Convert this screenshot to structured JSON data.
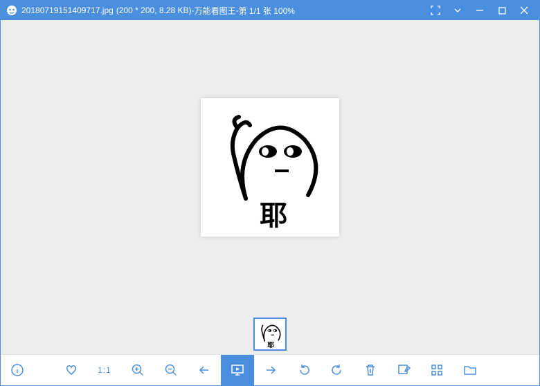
{
  "titlebar": {
    "filename": "20180719151409717.jpg",
    "dimensions": "(200 * 200, 8.28 KB)",
    "separator": " - ",
    "appname": "万能看图王",
    "pageinfo": "第 1/1 张 100%"
  },
  "image": {
    "caption": "耶"
  },
  "toolbar": {
    "ratio_label": "1:1"
  },
  "icons": {
    "app": "app-icon",
    "fullscreen": "fullscreen-icon",
    "dropdown": "dropdown-icon",
    "minimize": "minimize-icon",
    "maximize": "maximize-icon",
    "close": "close-icon",
    "info": "info-icon",
    "favorite": "heart-icon",
    "zoom_in": "zoom-in-icon",
    "zoom_out": "zoom-out-icon",
    "prev": "arrow-left-icon",
    "slideshow": "slideshow-icon",
    "next": "arrow-right-icon",
    "rotate_left": "rotate-left-icon",
    "rotate_right": "rotate-right-icon",
    "delete": "trash-icon",
    "edit": "edit-icon",
    "grid": "grid-icon",
    "folder": "folder-icon"
  }
}
